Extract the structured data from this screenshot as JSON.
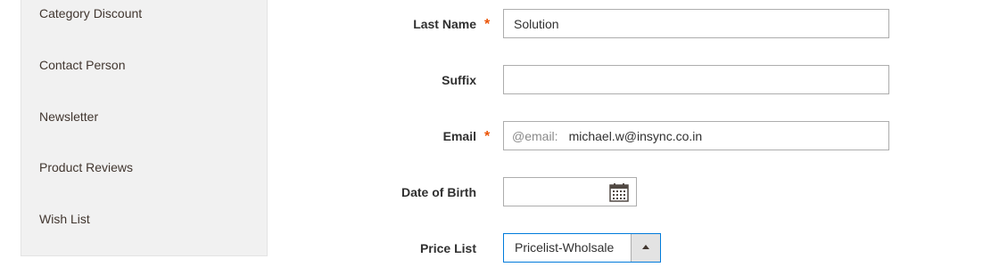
{
  "sidebar": {
    "items": [
      {
        "label": "Category Discount"
      },
      {
        "label": "Contact Person"
      },
      {
        "label": "Newsletter"
      },
      {
        "label": "Product Reviews"
      },
      {
        "label": "Wish List"
      }
    ]
  },
  "form": {
    "last_name": {
      "label": "Last Name",
      "required": "*",
      "value": "Solution"
    },
    "suffix": {
      "label": "Suffix",
      "value": ""
    },
    "email": {
      "label": "Email",
      "required": "*",
      "prefix": "@email:",
      "value": "michael.w@insync.co.in"
    },
    "dob": {
      "label": "Date of Birth",
      "value": "",
      "icon": "calendar-icon"
    },
    "price_list": {
      "label": "Price List",
      "selected": "Pricelist-Wholsale",
      "icon": "chevron-up-icon"
    }
  },
  "colors": {
    "required_asterisk": "#eb5202",
    "focus_border": "#007bdb",
    "sidebar_bg": "#f1f1f1"
  }
}
